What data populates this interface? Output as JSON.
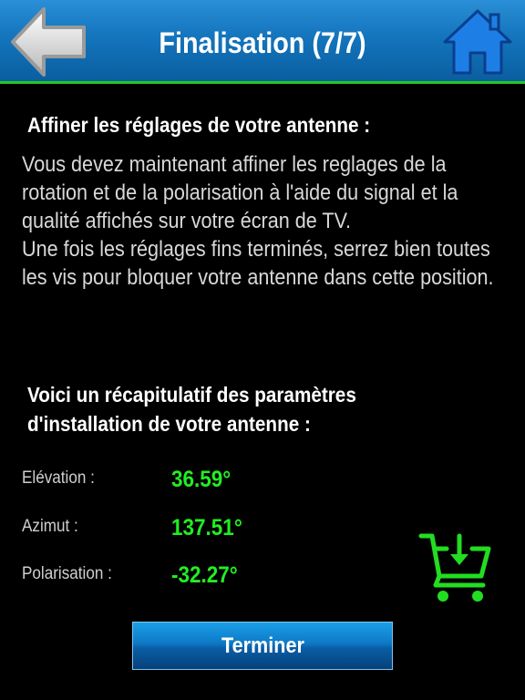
{
  "header": {
    "title": "Finalisation (7/7)",
    "back_icon": "arrow-left-icon",
    "home_icon": "home-icon"
  },
  "instructions": {
    "heading": "Affiner les réglages de votre antenne :",
    "paragraph1": "Vous devez maintenant affiner les reglages de la rotation et de la polarisation à l'aide du signal et la qualité affichés sur votre écran de  TV.",
    "paragraph2": "Une fois les réglages fins terminés, serrez bien toutes les vis pour bloquer votre antenne dans cette position."
  },
  "summary": {
    "heading_line1": "Voici un récapitulatif des paramètres",
    "heading_line2": "d'installation de votre antenne :",
    "params": [
      {
        "label": "Elévation :",
        "value": "36.59°"
      },
      {
        "label": "Azimut :",
        "value": "137.51°"
      },
      {
        "label": "Polarisation :",
        "value": "-32.27°"
      }
    ],
    "cart_icon": "cart-download-icon"
  },
  "footer": {
    "finish_label": "Terminer"
  },
  "colors": {
    "header_blue": "#1475bd",
    "header_line": "#27c427",
    "value_green": "#22ee22",
    "background": "#000000"
  }
}
